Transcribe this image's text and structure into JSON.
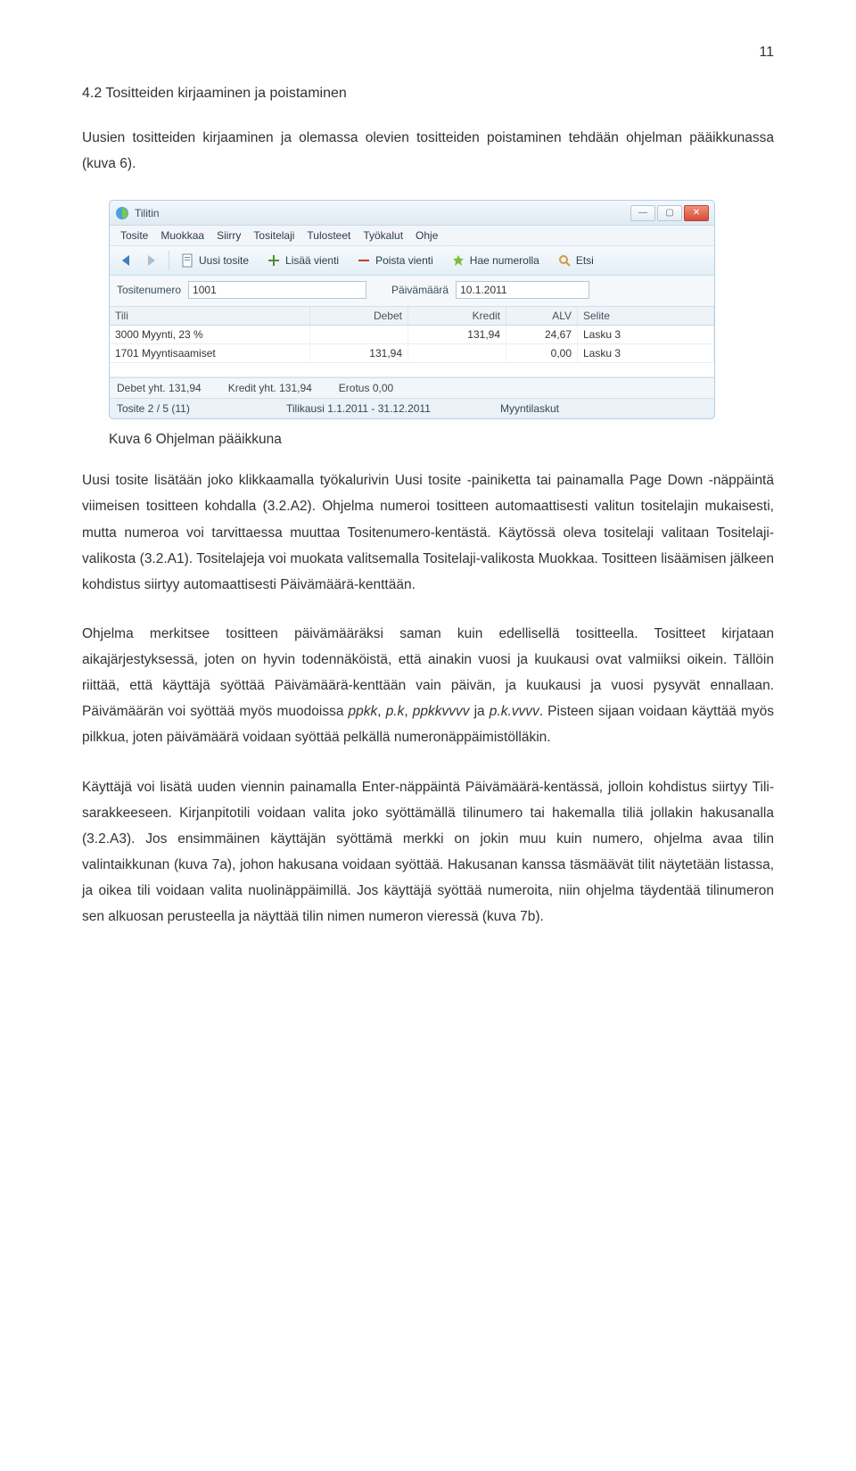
{
  "page_number": "11",
  "heading": "4.2 Tositteiden kirjaaminen ja poistaminen",
  "intro": "Uusien tositteiden kirjaaminen ja olemassa olevien tositteiden poistaminen tehdään ohjelman pääikkunassa (kuva 6).",
  "caption_prefix": "Kuva 6",
  "caption_rest": "   Ohjelman pääikkuna",
  "p2_a": "Uusi tosite lisätään joko klikkaamalla työkalurivin Uusi tosite -painiketta tai painamalla Page Down -näppäintä viimeisen tositteen kohdalla (3.2.A2). Ohjelma numeroi tositteen automaattisesti valitun tositelajin mukaisesti, mutta numeroa voi tarvittaessa muuttaa Tositenumero-kentästä. Käytössä oleva tositelaji valitaan Tositelaji-valikosta (3.2.A1). Tositelajeja voi muokata valitsemalla Tositelaji-valikosta Muokkaa. Tositteen lisäämisen jälkeen kohdistus siirtyy automaattisesti Päivämäärä-kenttään.",
  "p3_a": "Ohjelma merkitsee tositteen päivämääräksi saman kuin edellisellä tositteella. Tositteet kirjataan aikajärjestyksessä, joten on hyvin todennäköistä, että ainakin vuosi ja kuukausi ovat valmiiksi oikein. Tällöin riittää, että käyttäjä syöttää Päivämäärä-kenttään vain päivän, ja kuukausi ja vuosi pysyvät ennallaan. Päivämäärän voi syöttää myös muodoissa ",
  "p3_i1": "ppkk",
  "p3_b": ", ",
  "p3_i2": "p.k",
  "p3_c": ", ",
  "p3_i3": "ppkkvvvv",
  "p3_d": " ja ",
  "p3_i4": "p.k.vvvv",
  "p3_e": ". Pisteen sijaan voidaan käyttää myös pilkkua, joten päivämäärä voidaan syöttää pelkällä numeronäppäimistölläkin.",
  "p4": "Käyttäjä voi lisätä uuden viennin painamalla Enter-näppäintä Päivämäärä-kentässä, jolloin kohdistus siirtyy Tili-sarakkeeseen. Kirjanpitotili voidaan valita joko syöttämällä tilinumero tai hakemalla tiliä jollakin hakusanalla (3.2.A3). Jos ensimmäinen käyttäjän syöttämä merkki on jokin muu kuin numero, ohjelma avaa tilin valintaikkunan (kuva 7a), johon hakusana voidaan syöttää. Hakusanan kanssa täsmäävät tilit näytetään listassa, ja oikea tili voidaan valita nuolinäppäimillä. Jos käyttäjä syöttää numeroita, niin ohjelma täydentää tilinumeron sen alkuosan perusteella ja näyttää tilin nimen numeron vieressä (kuva 7b).",
  "screenshot": {
    "title": "Tilitin",
    "menus": [
      "Tosite",
      "Muokkaa",
      "Siirry",
      "Tositelaji",
      "Tulosteet",
      "Työkalut",
      "Ohje"
    ],
    "toolbar": {
      "uusi_tosite": "Uusi tosite",
      "lisaa_vienti": "Lisää vienti",
      "poista_vienti": "Poista vienti",
      "hae_numerolla": "Hae numerolla",
      "etsi": "Etsi"
    },
    "form": {
      "tositenumero_label": "Tositenumero",
      "tositenumero_value": "1001",
      "paivamaara_label": "Päivämäärä",
      "paivamaara_value": "10.1.2011"
    },
    "columns": {
      "tili": "Tili",
      "debet": "Debet",
      "kredit": "Kredit",
      "alv": "ALV",
      "selite": "Selite"
    },
    "rows": [
      {
        "tili": "3000 Myynti, 23 %",
        "debet": "",
        "kredit": "131,94",
        "alv": "24,67",
        "selite": "Lasku 3"
      },
      {
        "tili": "1701 Myyntisaamiset",
        "debet": "131,94",
        "kredit": "",
        "alv": "0,00",
        "selite": "Lasku 3"
      }
    ],
    "status1": {
      "debet": "Debet yht.  131,94",
      "kredit": "Kredit yht.  131,94",
      "erotus": "Erotus  0,00"
    },
    "status2": {
      "tosite": "Tosite 2 / 5 (11)",
      "tilikausi": "Tilikausi  1.1.2011 - 31.12.2011",
      "laji": "Myyntilaskut"
    }
  }
}
